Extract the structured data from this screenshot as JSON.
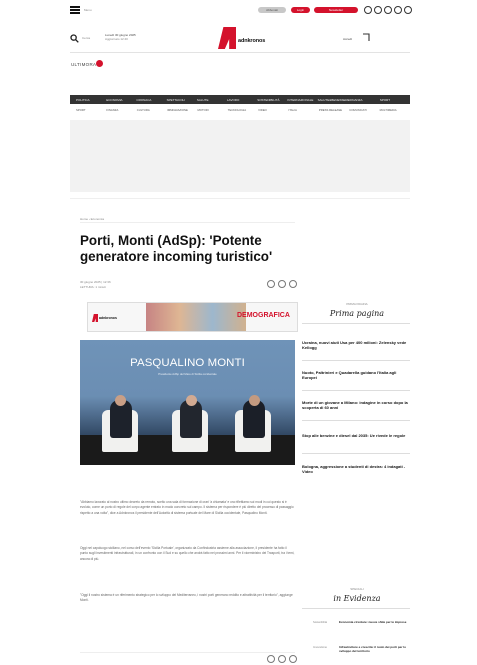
{
  "header": {
    "menu_label": "Menu",
    "top_pills": [
      {
        "label": "Abbonati",
        "color": "#c8c8c8"
      },
      {
        "label": "Login",
        "color": "#d4122c"
      },
      {
        "label": "Newsletter",
        "color": "#d4122c"
      }
    ],
    "social_icons": [
      "facebook-icon",
      "twitter-icon",
      "instagram-icon",
      "linkedin-icon",
      "youtube-icon"
    ],
    "search_label": "Cerca",
    "date_text": "Lunedì 30 giugno 2025",
    "date_sub": "Aggiornato 12:40",
    "logo_text": "adnkronos",
    "login_label": "Accedi",
    "sub_brand": "ULTIMORA"
  },
  "nav": {
    "main": [
      "POLITICA",
      "ECONOMIA",
      "CRONACA",
      "SPETTACOLI",
      "SALUTE",
      "LAVORO",
      "SOSTENIBILITÀ",
      "INTERNAZIONALE",
      "SALUTE&BENESSERE",
      "FINANZA",
      "SPORT"
    ],
    "sub": [
      "SPORT",
      "FINANZA",
      "CULTURA",
      "IMMIGRAZIONE",
      "MOTORI",
      "TECNOLOGIA",
      "VIDEO",
      "ITALIA",
      "PRESS RELEASE",
      "COMUNICATI",
      "MULTIMEDIA"
    ]
  },
  "article": {
    "breadcrumb": "Home › Economia",
    "title": "Porti, Monti (AdSp): 'Potente generatore incoming turistico'",
    "date": "30 giugno 2025 | 12:36",
    "byline": "LETTURA: 1 minuti",
    "banner_label": "DEMOGRAFICA",
    "photo_caption": "PASQUALINO MONTI",
    "photo_sub": "Presidente AdSp del Mare di Sicilia occidentale",
    "paragraphs": [
      "\"Abbiamo lavorato al nostro ultimo decreto da remoto, scelto una sala di formazione di orari 'a chiamata' e ora riflettiamo sui modi in cui questo si è evoluto, come un porto di regole del corpo agente entrato in modo concreto sul campo. Il sistema per rispondere è più diretto del processo di passaggio rispetto a una volta\", dice a Adnkronos il presidente dell'Autorità di sistema portuale del Mare di Sicilia occidentale, Pasqualino Monti.",
      "Oggi nel capoluogo siciliano, nel corso dell'evento 'Sicilia Portuale', organizzato da Confindustria assieme alla associazione, il presidente ha fatto il punto sugli investimenti infrastrutturali, in un confronto con il Sud e su quello che andrà fatto nei prossimi anni. Per il viceministro dei Trasporti, tra i temi, ancora di più.",
      "\"Oggi il nostro sistema è un riferimento strategico per lo sviluppo del Mediterraneo, i nostri porti generano reddito e attrattività per il territorio\", aggiunge Monti."
    ]
  },
  "sidebar": {
    "section_small": "PRIMA PAGINA",
    "section_title": "Prima pagina",
    "items": [
      "Ucraina, nuovi aiuti Usa per 400 milioni: Zelensky vede Kellogg",
      "Nuoto, Paltrinieri e Quadarella guidano l'Italia agli Europei",
      "Morte di un giovane a Milano: indagine in corso dopo la scoperta di 60 anni",
      "Stop alle benzine e diesel dal 2035: Ue rivede le regole",
      "Bologna, aggressione a studenti di destra: 4 indagati - Video"
    ],
    "evidence_small": "SPECIALI",
    "evidence_title": "in Evidenza",
    "evidence": [
      {
        "label": "Sostenibilità",
        "title": "Economia circolare: nuove sfide per le imprese"
      },
      {
        "label": "Innovazione",
        "title": "Infrastrutture e crescita: il ruolo dei porti per lo sviluppo del territorio"
      }
    ]
  }
}
